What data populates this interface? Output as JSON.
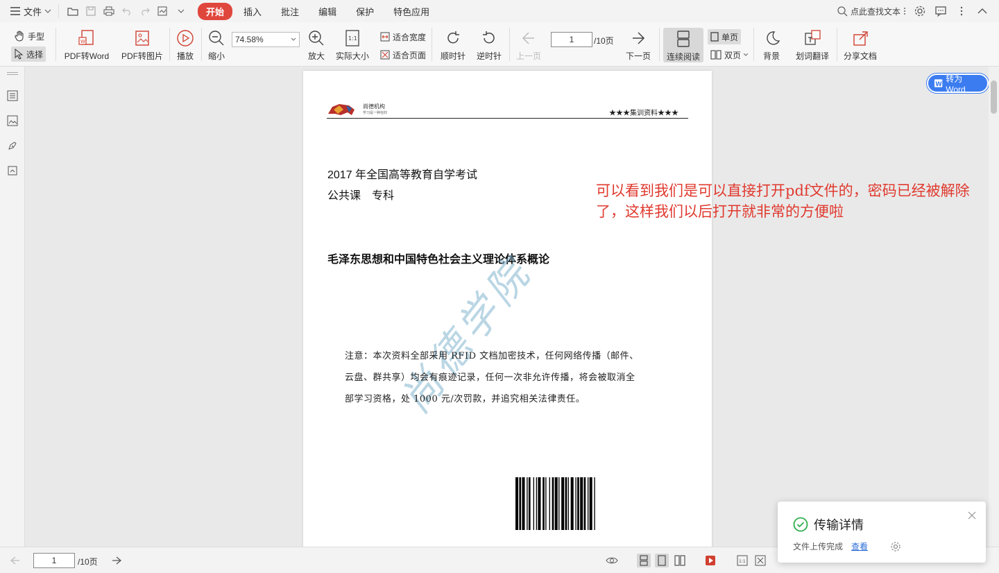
{
  "menubar": {
    "file_label": "文件",
    "tabs": [
      {
        "label": "开始",
        "active": true
      },
      {
        "label": "插入",
        "active": false
      },
      {
        "label": "批注",
        "active": false
      },
      {
        "label": "编辑",
        "active": false
      },
      {
        "label": "保护",
        "active": false
      },
      {
        "label": "特色应用",
        "active": false
      }
    ],
    "search_label": "点此查找文本",
    "accent_color": "#e0473c"
  },
  "ribbon": {
    "hand_tool": "手型",
    "select_tool": "选择",
    "pdf_to_word": "PDF转Word",
    "pdf_to_image": "PDF转图片",
    "play": "播放",
    "zoom_out": "缩小",
    "zoom_value": "74.58%",
    "zoom_in": "放大",
    "actual_size": "实际大小",
    "fit_width": "适合宽度",
    "fit_page": "适合页面",
    "rotate_cw": "顺时针",
    "rotate_ccw": "逆时针",
    "prev_page": "上一页",
    "page_current": "1",
    "page_total": "/10页",
    "next_page": "下一页",
    "continuous": "连续阅读",
    "single_page": "单页",
    "double_page": "双页",
    "background": "背景",
    "translate": "划词翻译",
    "share": "分享文档"
  },
  "document": {
    "header_brand": "尚德机构",
    "header_slogan": "学习是一种信仰",
    "header_right": "★★★集训资料★★★",
    "exam_line1": "2017 年全国高等教育自学考试",
    "exam_line2": "公共课　专科",
    "course_title": "毛泽东思想和中国特色社会主义理论体系概论",
    "notice": "注意：本次资料全部采用 RFID 文档加密技术，任何网络传播（邮件、云盘、群共享）均会有痕迹记录，任何一次非允许传播，将会被取消全部学习资格，处 1000 元/次罚款，并追究相关法律责任。",
    "watermark": "尚德学院"
  },
  "annotation": "可以看到我们是可以直接打开pdf文件的，密码已经被解除了，这样我们以后打开就非常的方便啦",
  "convert_button": "转为Word",
  "statusbar": {
    "page_current": "1",
    "page_total": "/10页"
  },
  "toast": {
    "title": "传输详情",
    "message": "文件上传完成",
    "link": "查看"
  }
}
